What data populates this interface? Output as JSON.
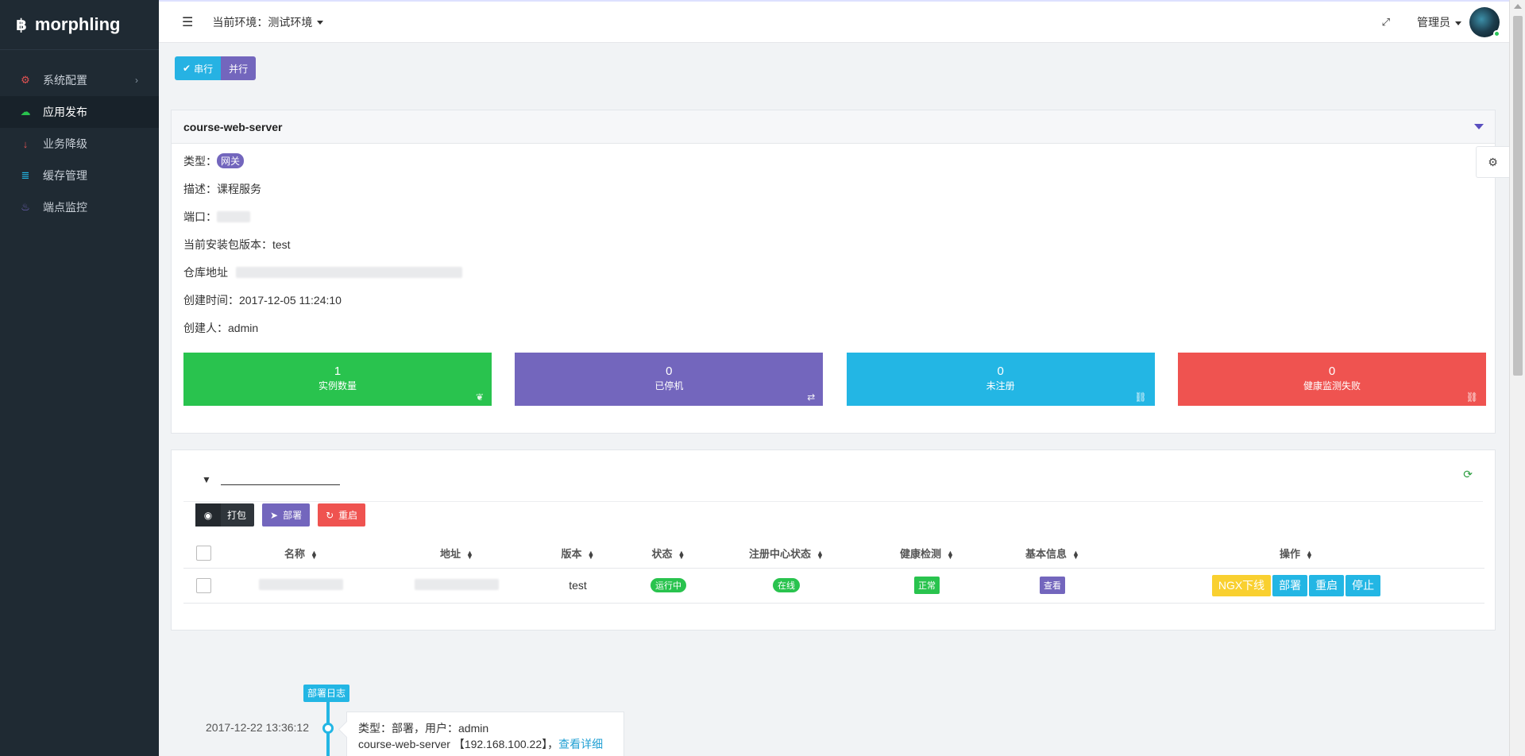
{
  "app": {
    "name": "morphling",
    "logo_glyph": "฿"
  },
  "sidebar": {
    "items": [
      {
        "label": "系统配置",
        "icon": "gear-icon",
        "glyph": "⚙",
        "color": "#e05252",
        "has_children": true
      },
      {
        "label": "应用发布",
        "icon": "cloud-upload-icon",
        "glyph": "☁",
        "color": "#29c34e",
        "active": true
      },
      {
        "label": "业务降级",
        "icon": "arrow-down-icon",
        "glyph": "↓",
        "color": "#e05252"
      },
      {
        "label": "缓存管理",
        "icon": "database-icon",
        "glyph": "≣",
        "color": "#23b6e4"
      },
      {
        "label": "端点监控",
        "icon": "fire-icon",
        "glyph": "♨",
        "color": "#7366bd"
      }
    ]
  },
  "topbar": {
    "env_label": "当前环境：",
    "env_value": "测试环境",
    "user": "管理员"
  },
  "mode": {
    "serial": "串行",
    "parallel": "并行"
  },
  "server": {
    "name": "course-web-server",
    "type_label": "类型：",
    "type_value": "网关",
    "desc_label": "描述：",
    "desc_value": "课程服务",
    "port_label": "端口：",
    "version_label": "当前安装包版本：",
    "version_value": "test",
    "repo_label": "仓库地址",
    "created_label": "创建时间：",
    "created_value": "2017-12-05 11:24:10",
    "creator_label": "创建人：",
    "creator_value": "admin"
  },
  "stats": [
    {
      "value": "1",
      "label": "实例数量",
      "color": "#29c34e",
      "icon": "leaf-icon"
    },
    {
      "value": "0",
      "label": "已停机",
      "color": "#7366bd",
      "icon": "exchange-icon"
    },
    {
      "value": "0",
      "label": "未注册",
      "color": "#23b6e4",
      "icon": "unlink-icon"
    },
    {
      "value": "0",
      "label": "健康监测失败",
      "color": "#ef5350",
      "icon": "unlink-icon"
    }
  ],
  "toolbar": {
    "pack": "打包",
    "deploy": "部署",
    "restart": "重启"
  },
  "table": {
    "headers": [
      "名称",
      "地址",
      "版本",
      "状态",
      "注册中心状态",
      "健康检测",
      "基本信息",
      "操作"
    ],
    "rows": [
      {
        "version": "test",
        "status": "运行中",
        "registry": "在线",
        "health": "正常",
        "info": "查看",
        "ops": [
          "NGX下线",
          "部署",
          "重启",
          "停止"
        ]
      }
    ]
  },
  "timeline": {
    "badge": "部署日志",
    "time": "2017-12-22 13:36:12",
    "line1": "类型：部署，用户：admin",
    "line2": "course-web-server 【192.168.100.22】，",
    "link": "查看详细"
  }
}
